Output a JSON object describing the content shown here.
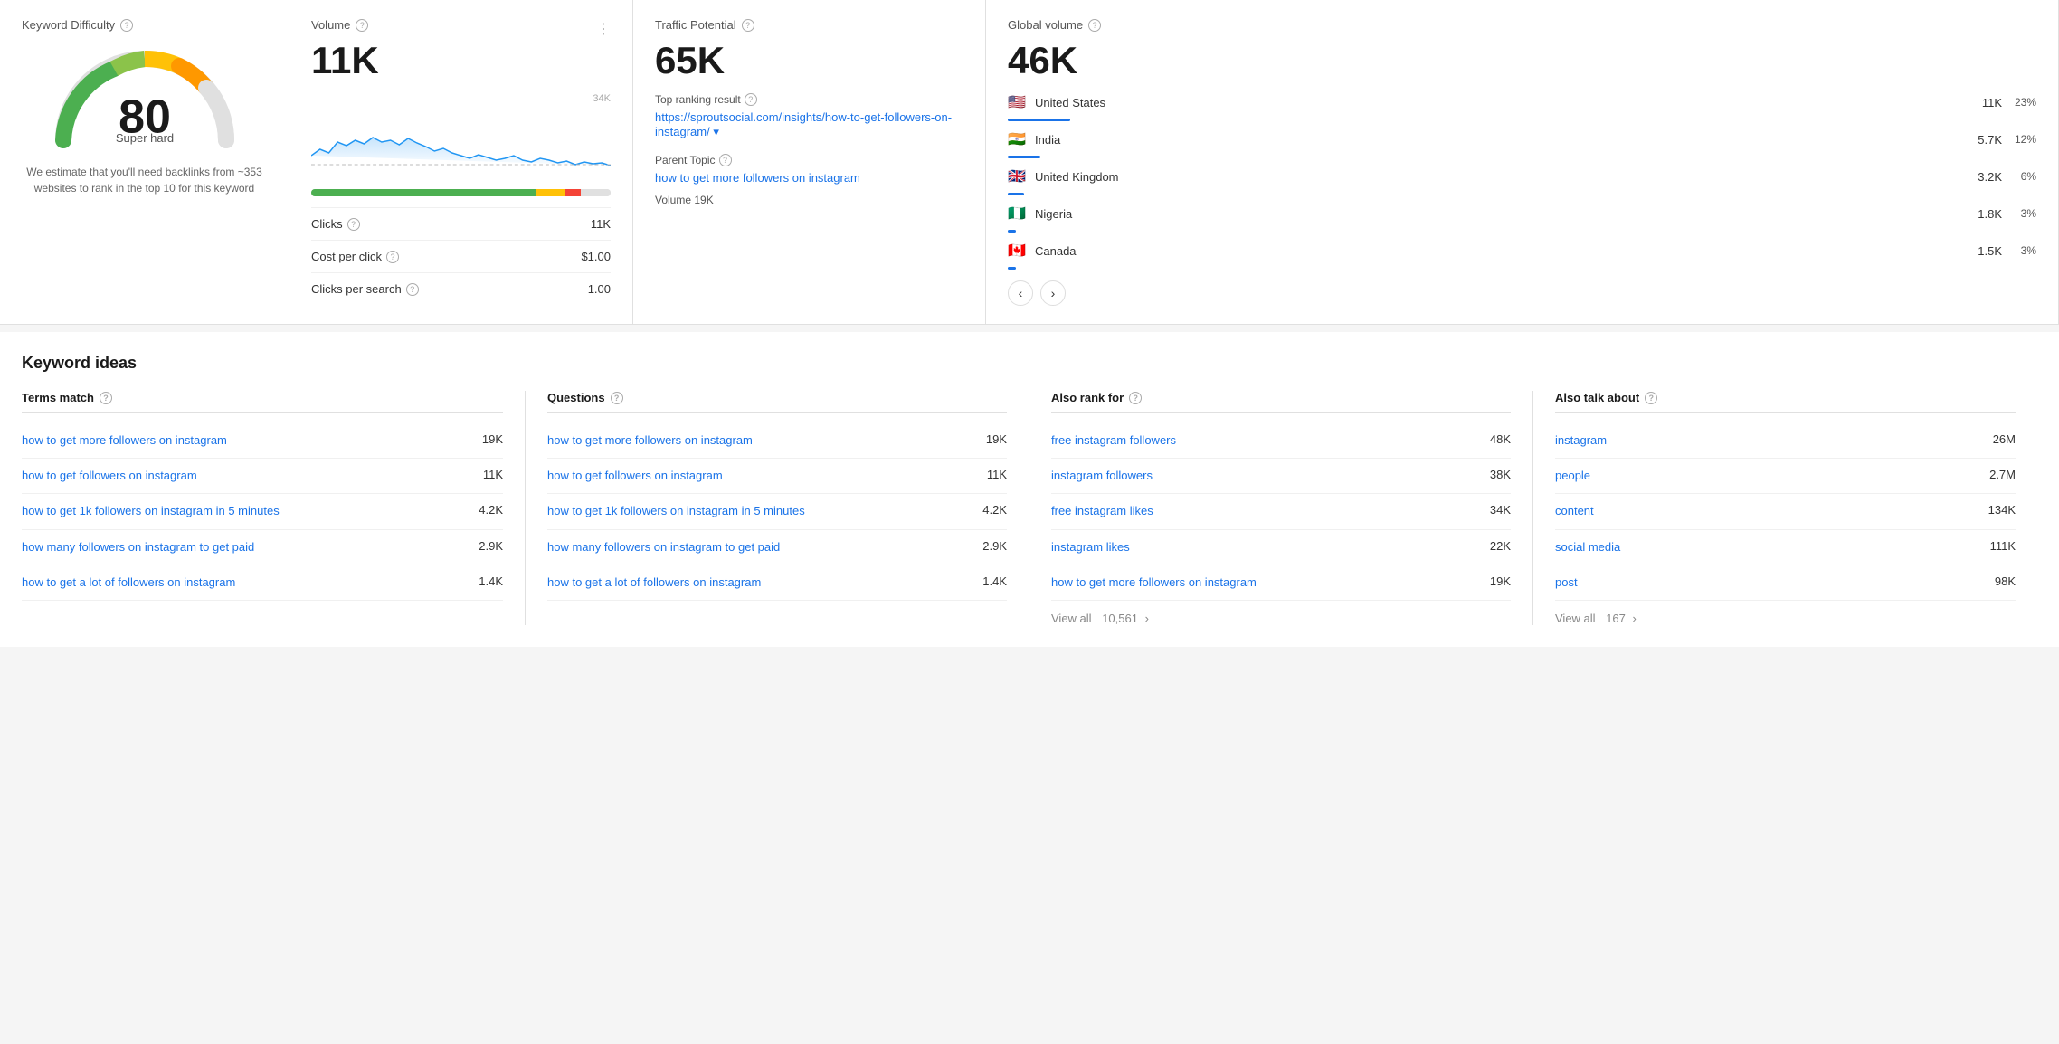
{
  "panels": {
    "keyword_difficulty": {
      "title": "Keyword Difficulty",
      "score": 80,
      "label": "Super hard",
      "description": "We estimate that you'll need backlinks from ~353 websites to rank in the top 10 for this keyword"
    },
    "volume": {
      "title": "Volume",
      "value": "11K",
      "chart_max": "34K",
      "clicks_label": "Clicks",
      "clicks_help": "?",
      "clicks_value": "11K",
      "cost_per_click_label": "Cost per click",
      "cost_per_click_value": "$1.00",
      "clicks_per_search_label": "Clicks per search",
      "clicks_per_search_value": "1.00"
    },
    "traffic_potential": {
      "title": "Traffic Potential",
      "value": "65K",
      "top_ranking_label": "Top ranking result",
      "top_ranking_url": "https://sproutsocial.com/insights/how-to-get-followers-on-instagram/",
      "parent_topic_label": "Parent Topic",
      "parent_topic_link": "how to get more followers on instagram",
      "volume_label": "Volume 19K"
    },
    "global_volume": {
      "title": "Global volume",
      "value": "46K",
      "countries": [
        {
          "flag": "🇺🇸",
          "name": "United States",
          "volume": "11K",
          "pct": "23%",
          "bar_width": "23"
        },
        {
          "flag": "🇮🇳",
          "name": "India",
          "volume": "5.7K",
          "pct": "12%",
          "bar_width": "12"
        },
        {
          "flag": "🇬🇧",
          "name": "United Kingdom",
          "volume": "3.2K",
          "pct": "6%",
          "bar_width": "6"
        },
        {
          "flag": "🇳🇬",
          "name": "Nigeria",
          "volume": "1.8K",
          "pct": "3%",
          "bar_width": "3"
        },
        {
          "flag": "🇨🇦",
          "name": "Canada",
          "volume": "1.5K",
          "pct": "3%",
          "bar_width": "3"
        }
      ]
    }
  },
  "keyword_ideas": {
    "section_title": "Keyword ideas",
    "terms_match": {
      "header": "Terms match",
      "items": [
        {
          "label": "how to get more followers on instagram",
          "volume": "19K"
        },
        {
          "label": "how to get followers on instagram",
          "volume": "11K"
        },
        {
          "label": "how to get 1k followers on instagram in 5 minutes",
          "volume": "4.2K"
        },
        {
          "label": "how many followers on instagram to get paid",
          "volume": "2.9K"
        },
        {
          "label": "how to get a lot of followers on instagram",
          "volume": "1.4K"
        }
      ]
    },
    "questions": {
      "header": "Questions",
      "items": [
        {
          "label": "how to get more followers on instagram",
          "volume": "19K"
        },
        {
          "label": "how to get followers on instagram",
          "volume": "11K"
        },
        {
          "label": "how to get 1k followers on instagram in 5 minutes",
          "volume": "4.2K"
        },
        {
          "label": "how many followers on instagram to get paid",
          "volume": "2.9K"
        },
        {
          "label": "how to get a lot of followers on instagram",
          "volume": "1.4K"
        }
      ]
    },
    "also_rank_for": {
      "header": "Also rank for",
      "items": [
        {
          "label": "free instagram followers",
          "volume": "48K"
        },
        {
          "label": "instagram followers",
          "volume": "38K"
        },
        {
          "label": "free instagram likes",
          "volume": "34K"
        },
        {
          "label": "instagram likes",
          "volume": "22K"
        },
        {
          "label": "how to get more followers on instagram",
          "volume": "19K"
        }
      ],
      "view_all_label": "View all",
      "view_all_count": "10,561"
    },
    "also_talk_about": {
      "header": "Also talk about",
      "items": [
        {
          "label": "instagram",
          "volume": "26M"
        },
        {
          "label": "people",
          "volume": "2.7M"
        },
        {
          "label": "content",
          "volume": "134K"
        },
        {
          "label": "social media",
          "volume": "111K"
        },
        {
          "label": "post",
          "volume": "98K"
        }
      ],
      "view_all_label": "View all",
      "view_all_count": "167"
    }
  }
}
